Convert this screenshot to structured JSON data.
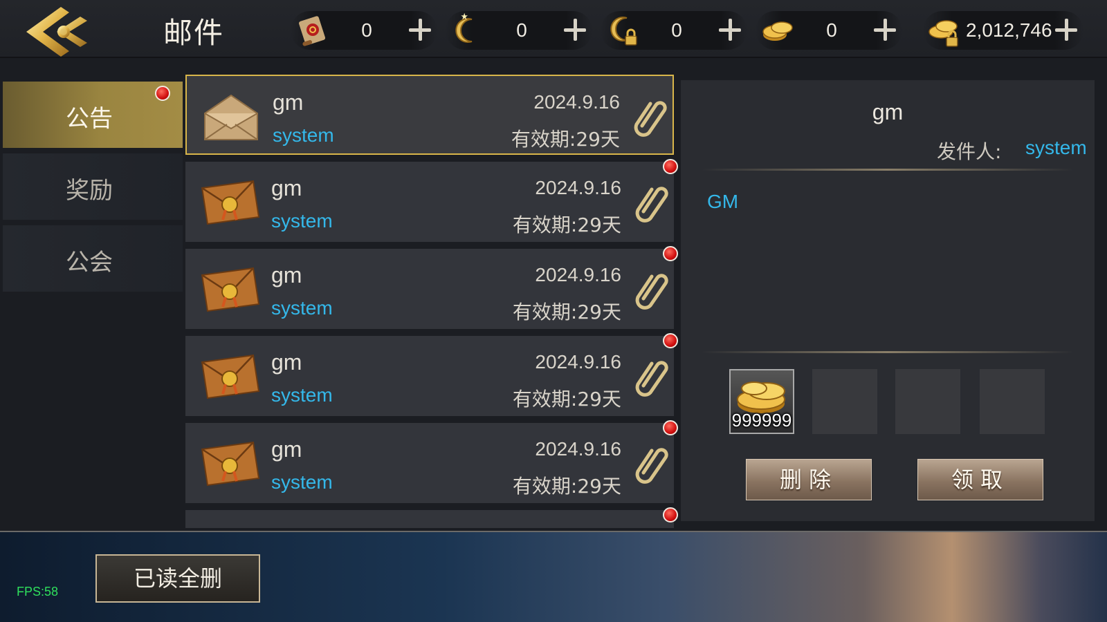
{
  "header": {
    "title": "邮件",
    "currencies": [
      {
        "icon": "scroll-icon",
        "value": "0"
      },
      {
        "icon": "crescent-coin-icon",
        "value": "0"
      },
      {
        "icon": "locked-crescent-coin-icon",
        "value": "0"
      },
      {
        "icon": "gold-coins-icon",
        "value": "0"
      },
      {
        "icon": "locked-gold-coins-icon",
        "value": "2,012,746"
      }
    ]
  },
  "sidebar": {
    "tabs": [
      {
        "label": "公告",
        "active": true,
        "unread": true
      },
      {
        "label": "奖励",
        "active": false,
        "unread": false
      },
      {
        "label": "公会",
        "active": false,
        "unread": false
      }
    ]
  },
  "mail_list": [
    {
      "title": "gm",
      "sender": "system",
      "date": "2024.9.16",
      "expire": "有效期:29天",
      "opened": true,
      "selected": true,
      "unread_dot": false,
      "attachment": true
    },
    {
      "title": "gm",
      "sender": "system",
      "date": "2024.9.16",
      "expire": "有效期:29天",
      "opened": false,
      "selected": false,
      "unread_dot": true,
      "attachment": true
    },
    {
      "title": "gm",
      "sender": "system",
      "date": "2024.9.16",
      "expire": "有效期:29天",
      "opened": false,
      "selected": false,
      "unread_dot": true,
      "attachment": true
    },
    {
      "title": "gm",
      "sender": "system",
      "date": "2024.9.16",
      "expire": "有效期:29天",
      "opened": false,
      "selected": false,
      "unread_dot": true,
      "attachment": true
    },
    {
      "title": "gm",
      "sender": "system",
      "date": "2024.9.16",
      "expire": "有效期:29天",
      "opened": false,
      "selected": false,
      "unread_dot": true,
      "attachment": true
    },
    {
      "title": "",
      "sender": "",
      "date": "",
      "expire": "",
      "opened": false,
      "selected": false,
      "unread_dot": true,
      "attachment": false
    }
  ],
  "detail": {
    "title": "gm",
    "sender_label": "发件人:",
    "sender": "system",
    "body": "GM",
    "attachments": [
      {
        "icon": "gold-coins-icon",
        "qty": "999999"
      },
      null,
      null,
      null
    ],
    "delete_label": "删除",
    "claim_label": "领取"
  },
  "footer": {
    "fps": "FPS:58",
    "delete_all_read_label": "已读全删"
  },
  "colors": {
    "accent_gold": "#a38c45",
    "sender_blue": "#34b8ea",
    "unread_red": "#d10f0f",
    "panel_bg": "#2a2c31"
  }
}
